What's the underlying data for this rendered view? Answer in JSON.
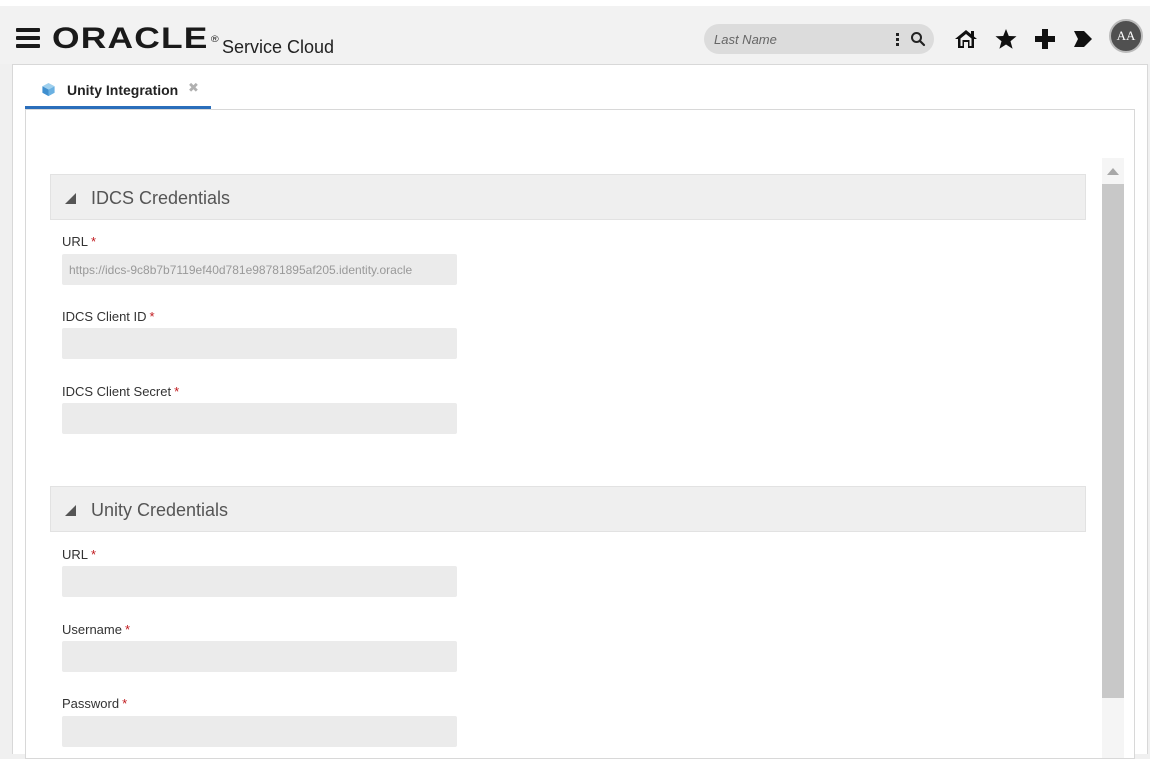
{
  "header": {
    "logo_text": "ORACLE",
    "logo_mark": "®",
    "product_name": "Service Cloud",
    "search": {
      "placeholder": "Last Name"
    },
    "icons": [
      "menu-icon",
      "search-options-icon",
      "search-icon",
      "home-icon",
      "star-icon",
      "plus-icon",
      "notifications-icon"
    ],
    "avatar_initials": "AA"
  },
  "tabs": [
    {
      "label": "Unity Integration",
      "icon": "cube-icon",
      "close": "✖"
    }
  ],
  "sections": [
    {
      "title": "IDCS Credentials",
      "fields": [
        {
          "label": "URL",
          "required": "*",
          "value": "https://idcs-9c8b7b7119ef40d781e98781895af205.identity.oracle",
          "placeholder": ""
        },
        {
          "label": "IDCS Client ID",
          "required": "*",
          "value": "",
          "placeholder": ""
        },
        {
          "label": "IDCS Client Secret",
          "required": "*",
          "value": "",
          "placeholder": ""
        }
      ]
    },
    {
      "title": "Unity Credentials",
      "fields": [
        {
          "label": "URL",
          "required": "*",
          "value": "",
          "placeholder": ""
        },
        {
          "label": "Username",
          "required": "*",
          "value": "",
          "placeholder": ""
        },
        {
          "label": "Password",
          "required": "*",
          "value": "",
          "placeholder": ""
        }
      ]
    }
  ],
  "colors": {
    "accent": "#2a6ebb",
    "required": "#c0181d",
    "input_bg": "#ebebeb",
    "section_bg": "#efefef"
  }
}
